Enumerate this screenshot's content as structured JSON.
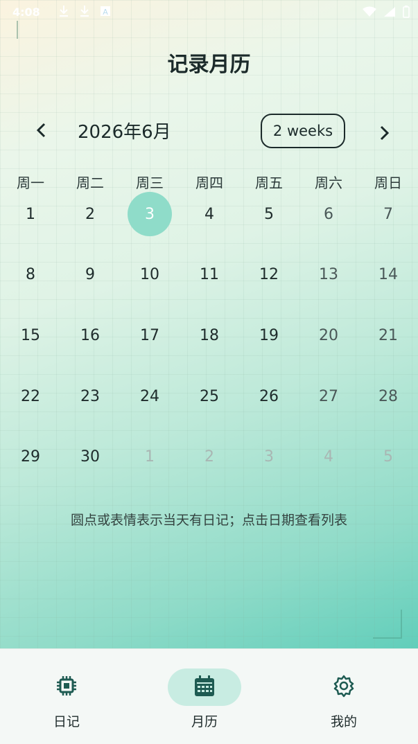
{
  "status": {
    "time": "4:08"
  },
  "title": "记录月历",
  "calendar": {
    "month_label": "2026年6月",
    "format_button": "2 weeks",
    "weekdays": [
      "周一",
      "周二",
      "周三",
      "周四",
      "周五",
      "周六",
      "周日"
    ],
    "weeks": [
      [
        "1",
        "2",
        "3",
        "4",
        "5",
        "6",
        "7"
      ],
      [
        "8",
        "9",
        "10",
        "11",
        "12",
        "13",
        "14"
      ],
      [
        "15",
        "16",
        "17",
        "18",
        "19",
        "20",
        "21"
      ],
      [
        "22",
        "23",
        "24",
        "25",
        "26",
        "27",
        "28"
      ],
      [
        "29",
        "30",
        "1",
        "2",
        "3",
        "4",
        "5"
      ]
    ],
    "selected_day": "3",
    "accent_color": "#8fdcc9"
  },
  "hint": "圆点或表情表示当天有日记；点击日期查看列表",
  "bottom_nav": {
    "items": [
      {
        "label": "日记",
        "icon": "chip-icon"
      },
      {
        "label": "月历",
        "icon": "calendar-icon"
      },
      {
        "label": "我的",
        "icon": "gear-icon"
      }
    ],
    "active_index": 1
  }
}
